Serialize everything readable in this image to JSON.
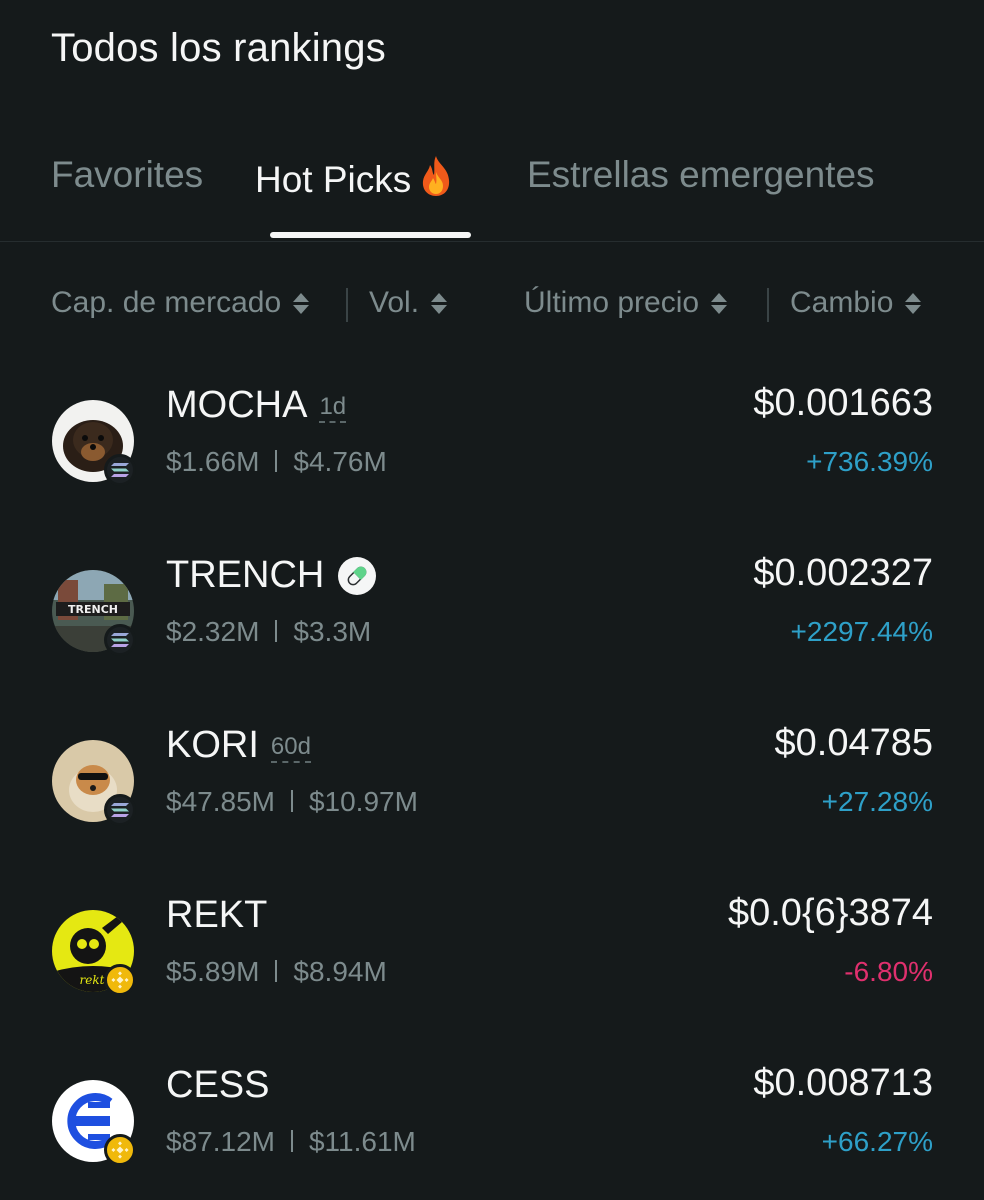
{
  "page": {
    "title": "Todos los rankings"
  },
  "tabs": [
    {
      "label": "Favorites",
      "active": false
    },
    {
      "label": "Hot Picks",
      "active": true,
      "icon": "fire-icon"
    },
    {
      "label": "Estrellas emergentes",
      "active": false
    }
  ],
  "sort": {
    "market_cap": "Cap. de mercado",
    "volume": "Vol.",
    "last_price": "Último precio",
    "change": "Cambio"
  },
  "colors": {
    "positive": "#2ea0c8",
    "negative": "#e0306e",
    "background": "#151a1b"
  },
  "tokens": [
    {
      "symbol": "MOCHA",
      "age": "1d",
      "chain": "solana",
      "market_cap": "$1.66M",
      "volume": "$4.76M",
      "price": "$0.001663",
      "change": "+736.39%",
      "direction": "up"
    },
    {
      "symbol": "TRENCH",
      "age": "",
      "verified_icon": "pill-icon",
      "chain": "solana",
      "market_cap": "$2.32M",
      "volume": "$3.3M",
      "price": "$0.002327",
      "change": "+2297.44%",
      "direction": "up"
    },
    {
      "symbol": "KORI",
      "age": "60d",
      "chain": "solana",
      "market_cap": "$47.85M",
      "volume": "$10.97M",
      "price": "$0.04785",
      "change": "+27.28%",
      "direction": "up"
    },
    {
      "symbol": "REKT",
      "age": "",
      "chain": "bnb",
      "market_cap": "$5.89M",
      "volume": "$8.94M",
      "price": "$0.0{6}3874",
      "change": "-6.80%",
      "direction": "down"
    },
    {
      "symbol": "CESS",
      "age": "",
      "chain": "bnb",
      "market_cap": "$87.12M",
      "volume": "$11.61M",
      "price": "$0.008713",
      "change": "+66.27%",
      "direction": "up"
    }
  ]
}
